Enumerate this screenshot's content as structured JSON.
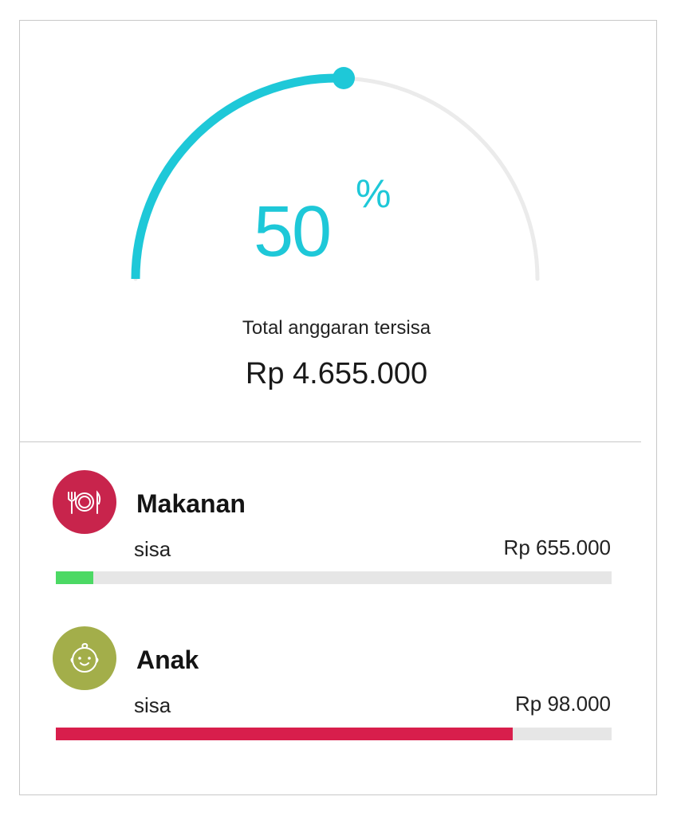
{
  "summary": {
    "percent": "50",
    "percent_sign": "%",
    "progress_fraction": 0.5,
    "label": "Total anggaran tersisa",
    "amount": "Rp 4.655.000"
  },
  "colors": {
    "accent": "#1ec8d8",
    "track": "#ebebeb",
    "green": "#4cd964",
    "red": "#d81e4c",
    "makanan_icon_bg": "#c8244c",
    "anak_icon_bg": "#a3ae4a"
  },
  "categories": [
    {
      "name": "Makanan",
      "icon": "plate-cutlery-icon",
      "sisa_label": "sisa",
      "amount": "Rp 655.000",
      "bar_fraction": 0.068,
      "bar_color": "#4cd964"
    },
    {
      "name": "Anak",
      "icon": "baby-face-icon",
      "sisa_label": "sisa",
      "amount": "Rp 98.000",
      "bar_fraction": 0.822,
      "bar_color": "#d81e4c"
    }
  ]
}
